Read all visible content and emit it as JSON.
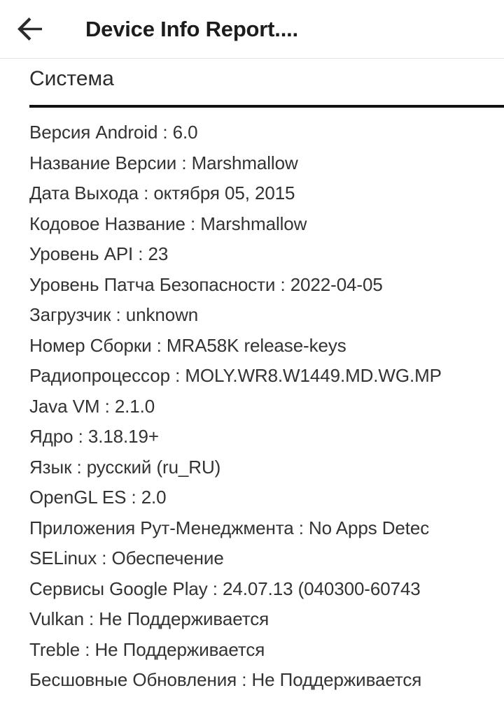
{
  "appbar": {
    "back_icon": "arrow-left-icon",
    "title": "Device Info Report...."
  },
  "section": {
    "heading": "Система"
  },
  "info_rows": [
    {
      "label": "Версия Android",
      "value": "6.0",
      "text": "Версия Android : 6.0"
    },
    {
      "label": "Название Версии",
      "value": "Marshmallow",
      "text": "Название Версии : Marshmallow"
    },
    {
      "label": "Дата Выхода",
      "value": "октября 05, 2015",
      "text": "Дата Выхода : октября 05, 2015"
    },
    {
      "label": "Кодовое Название",
      "value": "Marshmallow",
      "text": "Кодовое Название : Marshmallow"
    },
    {
      "label": "Уровень API",
      "value": "23",
      "text": "Уровень API : 23"
    },
    {
      "label": "Уровень Патча Безопасности",
      "value": "2022-04-05",
      "text": "Уровень Патча Безопасности : 2022-04-05"
    },
    {
      "label": "Загрузчик",
      "value": "unknown",
      "text": "Загрузчик : unknown"
    },
    {
      "label": "Номер Сборки",
      "value": "MRA58K release-keys",
      "text": "Номер Сборки : MRA58K release-keys"
    },
    {
      "label": "Радиопроцессор",
      "value": "MOLY.WR8.W1449.MD.WG.MP",
      "text": "Радиопроцессор : MOLY.WR8.W1449.MD.WG.MP"
    },
    {
      "label": "Java VM",
      "value": "2.1.0",
      "text": "Java VM : 2.1.0"
    },
    {
      "label": "Ядро",
      "value": "3.18.19+",
      "text": "Ядро : 3.18.19+"
    },
    {
      "label": "Язык",
      "value": "русский (ru_RU)",
      "text": "Язык : русский (ru_RU)"
    },
    {
      "label": "OpenGL ES",
      "value": "2.0",
      "text": "OpenGL ES : 2.0"
    },
    {
      "label": "Приложения Рут-Менеджмента",
      "value": "No Apps Detec",
      "text": "Приложения Рут-Менеджмента : No Apps Detec"
    },
    {
      "label": "SELinux",
      "value": "Обеспечение",
      "text": "SELinux : Обеспечение"
    },
    {
      "label": "Сервисы Google Play",
      "value": "24.07.13 (040300-60743",
      "text": "Сервисы Google Play : 24.07.13 (040300-60743"
    },
    {
      "label": "Vulkan",
      "value": "Не Поддерживается",
      "text": "Vulkan : Не Поддерживается"
    },
    {
      "label": "Treble",
      "value": "Не Поддерживается",
      "text": "Treble : Не Поддерживается"
    },
    {
      "label": "Бесшовные Обновления",
      "value": "Не Поддерживается",
      "text": "Бесшовные Обновления : Не Поддерживается"
    }
  ]
}
